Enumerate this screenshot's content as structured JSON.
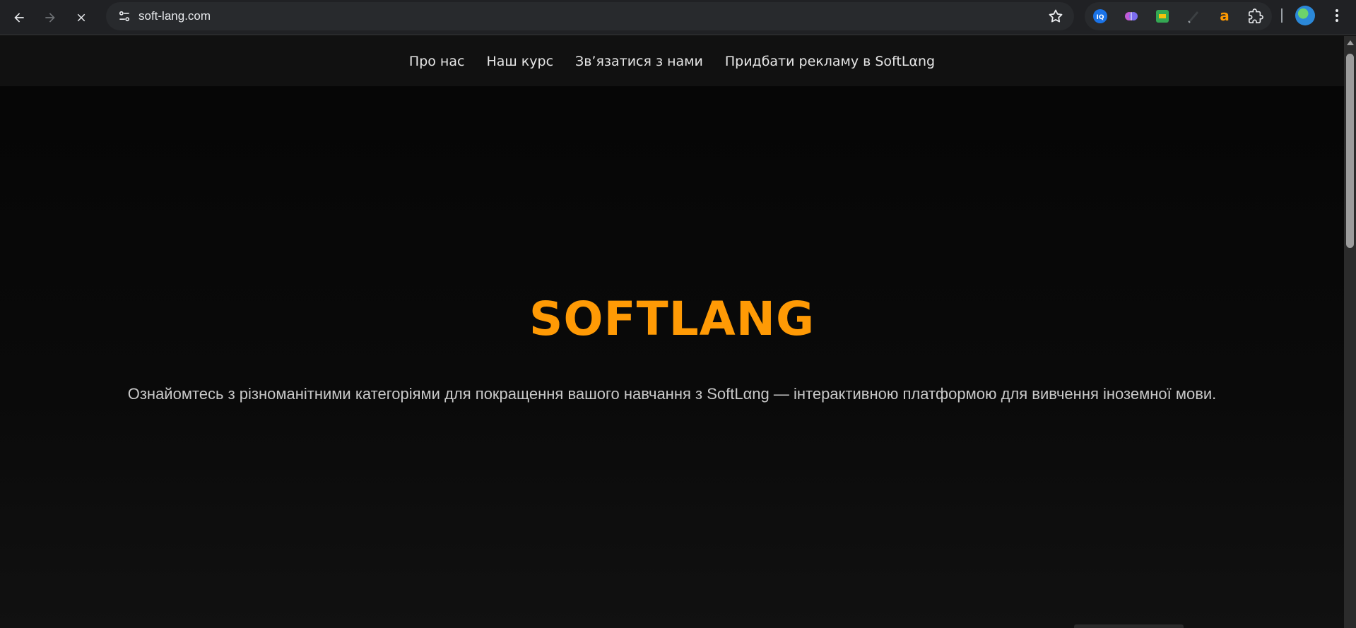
{
  "browser": {
    "url": "soft-lang.com",
    "icons": {
      "back": "arrow-left-icon",
      "forward": "arrow-right-icon",
      "stop": "close-icon",
      "site_settings": "tune-icon",
      "bookmark": "star-icon",
      "menu": "kebab-menu-icon"
    },
    "extensions": [
      {
        "name": "iq-extension-icon",
        "color": "#1a73e8",
        "glyph": "IQ"
      },
      {
        "name": "brain-extension-icon",
        "color": "#c05bd6",
        "glyph": "✿"
      },
      {
        "name": "green-extension-icon",
        "color": "#34a853",
        "glyph": "■"
      },
      {
        "name": "pen-extension-icon",
        "color": "#5f6368",
        "glyph": "✎"
      },
      {
        "name": "amazon-extension-icon",
        "color": "#ff9900",
        "glyph": "a"
      },
      {
        "name": "puzzle-extension-icon",
        "color": "#e8eaed",
        "glyph": "⧉"
      }
    ]
  },
  "site_nav": {
    "items": [
      "Про нас",
      "Наш курс",
      "Зв’язатися з нами",
      "Придбати рекламу в SoftLαng"
    ]
  },
  "hero": {
    "title": "SOFTLANG",
    "subtitle": "Ознайомтесь з різноманітними категоріями для покращення вашого навчання з SoftLαng — інтерактивною платформою для вивчення іноземної мови.",
    "accent_color": "#ff9a05"
  }
}
